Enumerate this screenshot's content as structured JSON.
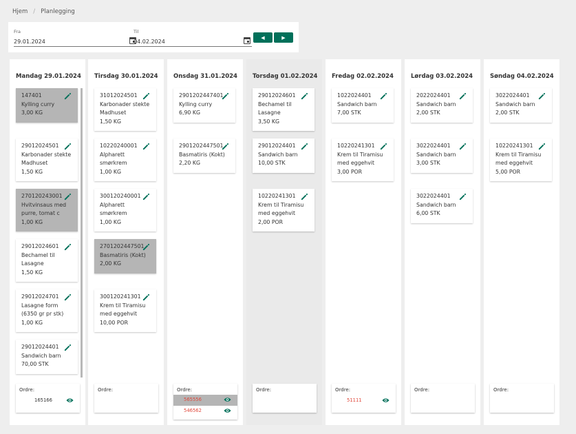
{
  "breadcrumb": {
    "home": "Hjem",
    "separator": "/",
    "current": "Planlegging"
  },
  "filter": {
    "from_label": "Fra",
    "from_value": "29.01.2024",
    "to_label": "Til",
    "to_value": "04.02.2024",
    "prev_icon": "chevron-left-icon",
    "next_icon": "chevron-right-icon",
    "prev_glyph": "◀",
    "next_glyph": "▶"
  },
  "colors": {
    "accent": "#00705a",
    "selected_card": "#b5b5b5",
    "order_red": "#e0473a"
  },
  "order_label": "Ordre:",
  "days": [
    {
      "header": "Mandag 29.01.2024",
      "cards": [
        {
          "code": "147401",
          "name1": "Kylling curry",
          "qty": "3,00 KG",
          "selected": true
        },
        {
          "code": "29012024501",
          "name1": "Karbonader stekte",
          "name2": "Madhuset",
          "qty": "1,50 KG"
        },
        {
          "code": "270120243001",
          "name1": "Hvitvinsaus med",
          "name2": "purre, tomat c",
          "qty": "1,00 KG",
          "selected": true
        },
        {
          "code": "29012024601",
          "name1": "Bechamel til",
          "name2": "Lasagne",
          "qty": "1,50 KG"
        },
        {
          "code": "29012024701",
          "name1": "Lasagne form",
          "name2": "(6350 gr pr stk)",
          "qty": "1,00 KG"
        },
        {
          "code": "29012024401",
          "name1": "Sandwich barn",
          "qty": "70,00 STK"
        }
      ],
      "orders": [
        {
          "number": "165166",
          "red": false,
          "selected": false
        }
      ]
    },
    {
      "header": "Tirsdag 30.01.2024",
      "cards": [
        {
          "code": "31012024501",
          "name1": "Karbonader stekte",
          "name2": "Madhuset",
          "qty": "1,50 KG"
        },
        {
          "code": "10220240001",
          "name1": "Alpharett",
          "name2": "smørkrem",
          "qty": "1,00 KG"
        },
        {
          "code": "300120240001",
          "name1": "Alpharett",
          "name2": "smørkrem",
          "qty": "1,00 KG"
        },
        {
          "code": "2701202447501",
          "name1": "Basmatiris (Kokt)",
          "qty": "2,00 KG",
          "selected": true
        },
        {
          "code": "300120241301",
          "name1": "Krem til Tiramisu",
          "name2": "med eggehvit",
          "qty": "10,00 POR"
        }
      ],
      "orders": []
    },
    {
      "header": "Onsdag 31.01.2024",
      "cards": [
        {
          "code": "2901202447401",
          "name1": "Kylling curry",
          "qty": "6,90 KG"
        },
        {
          "code": "2901202447501",
          "name1": "Basmatiris (Kokt)",
          "qty": "2,20 KG"
        }
      ],
      "orders": [
        {
          "number": "565556",
          "red": true,
          "selected": true
        },
        {
          "number": "546562",
          "red": true,
          "selected": false
        }
      ]
    },
    {
      "header": "Torsdag 01.02.2024",
      "today": true,
      "cards": [
        {
          "code": "29012024601",
          "name1": "Bechamel til",
          "name2": "Lasagne",
          "qty": "3,50 KG"
        },
        {
          "code": "29012024401",
          "name1": "Sandwich barn",
          "qty": "10,00 STK"
        },
        {
          "code": "10220241301",
          "name1": "Krem til Tiramisu",
          "name2": "med eggehvit",
          "qty": "2,00 POR"
        }
      ],
      "orders": []
    },
    {
      "header": "Fredag 02.02.2024",
      "cards": [
        {
          "code": "1022024401",
          "name1": "Sandwich barn",
          "qty": "7,00 STK"
        },
        {
          "code": "10220241301",
          "name1": "Krem til Tiramisu",
          "name2": "med eggehvit",
          "qty": "3,00 POR"
        }
      ],
      "orders": [
        {
          "number": "51111",
          "red": true,
          "selected": false
        }
      ]
    },
    {
      "header": "Lørdag 03.02.2024",
      "cards": [
        {
          "code": "2022024401",
          "name1": "Sandwich barn",
          "qty": "2,00 STK"
        },
        {
          "code": "3022024401",
          "name1": "Sandwich barn",
          "qty": "3,00 STK"
        },
        {
          "code": "3022024401",
          "name1": "Sandwich barn",
          "qty": "6,00 STK"
        }
      ],
      "orders": []
    },
    {
      "header": "Søndag 04.02.2024",
      "cards": [
        {
          "code": "3022024401",
          "name1": "Sandwich barn",
          "qty": "2,00 STK"
        },
        {
          "code": "10220241301",
          "name1": "Krem til Tiramisu",
          "name2": "med eggehvit",
          "qty": "5,00 POR"
        }
      ],
      "orders": []
    }
  ]
}
